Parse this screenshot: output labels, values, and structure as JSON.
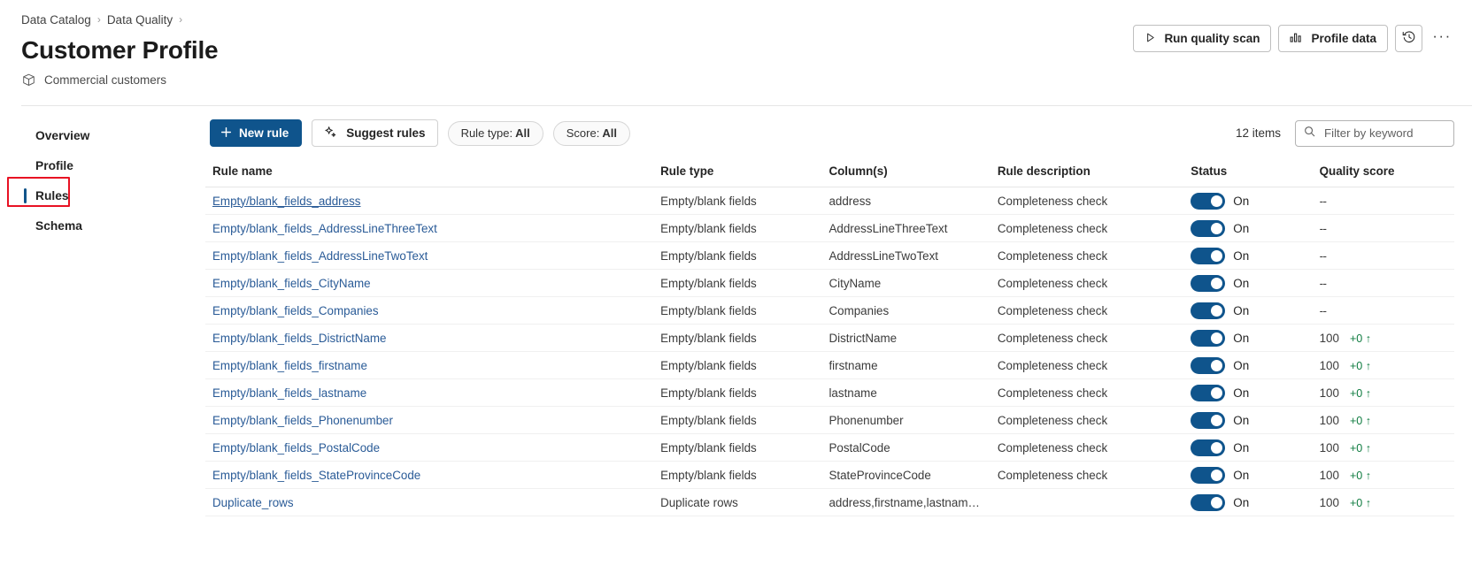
{
  "breadcrumb": {
    "items": [
      "Data Catalog",
      "Data Quality"
    ],
    "separator": "›"
  },
  "header": {
    "title": "Customer Profile",
    "subtitle": "Commercial customers",
    "subtitle_icon": "box-icon",
    "actions": {
      "run_quality_scan": "Run quality scan",
      "run_quality_scan_icon": "play-icon",
      "profile_data": "Profile data",
      "profile_data_icon": "bar-chart-icon",
      "history_icon": "history-clock-icon",
      "more_label": "···"
    }
  },
  "sidebar": {
    "items": [
      {
        "label": "Overview",
        "selected": false
      },
      {
        "label": "Profile",
        "selected": false
      },
      {
        "label": "Rules",
        "selected": true
      },
      {
        "label": "Schema",
        "selected": false
      }
    ],
    "annotation_color": "#e81123",
    "selected_indicator_color": "#11548a"
  },
  "toolbar": {
    "new_rule": "New rule",
    "new_rule_icon": "plus-icon",
    "suggest_rules": "Suggest rules",
    "suggest_rules_icon": "sparkle-icon",
    "filters": [
      {
        "prefix": "Rule type:",
        "value": "All"
      },
      {
        "prefix": "Score:",
        "value": "All"
      }
    ],
    "item_count": "12 items",
    "search_placeholder": "Filter by keyword",
    "search_value": "",
    "search_icon": "search-icon"
  },
  "table": {
    "columns": [
      "Rule name",
      "Rule type",
      "Column(s)",
      "Rule description",
      "Status",
      "Quality score"
    ],
    "toggle_on_label": "On",
    "no_score_text": "--",
    "rows": [
      {
        "name": "Empty/blank_fields_address",
        "type": "Empty/blank fields",
        "columns": "address",
        "description": "Completeness check",
        "status": "On",
        "score": "--",
        "delta": ""
      },
      {
        "name": "Empty/blank_fields_AddressLineThreeText",
        "type": "Empty/blank fields",
        "columns": "AddressLineThreeText",
        "description": "Completeness check",
        "status": "On",
        "score": "--",
        "delta": ""
      },
      {
        "name": "Empty/blank_fields_AddressLineTwoText",
        "type": "Empty/blank fields",
        "columns": "AddressLineTwoText",
        "description": "Completeness check",
        "status": "On",
        "score": "--",
        "delta": ""
      },
      {
        "name": "Empty/blank_fields_CityName",
        "type": "Empty/blank fields",
        "columns": "CityName",
        "description": "Completeness check",
        "status": "On",
        "score": "--",
        "delta": ""
      },
      {
        "name": "Empty/blank_fields_Companies",
        "type": "Empty/blank fields",
        "columns": "Companies",
        "description": "Completeness check",
        "status": "On",
        "score": "--",
        "delta": ""
      },
      {
        "name": "Empty/blank_fields_DistrictName",
        "type": "Empty/blank fields",
        "columns": "DistrictName",
        "description": "Completeness check",
        "status": "On",
        "score": "100",
        "delta": "+0 ↑"
      },
      {
        "name": "Empty/blank_fields_firstname",
        "type": "Empty/blank fields",
        "columns": "firstname",
        "description": "Completeness check",
        "status": "On",
        "score": "100",
        "delta": "+0 ↑"
      },
      {
        "name": "Empty/blank_fields_lastname",
        "type": "Empty/blank fields",
        "columns": "lastname",
        "description": "Completeness check",
        "status": "On",
        "score": "100",
        "delta": "+0 ↑"
      },
      {
        "name": "Empty/blank_fields_Phonenumber",
        "type": "Empty/blank fields",
        "columns": "Phonenumber",
        "description": "Completeness check",
        "status": "On",
        "score": "100",
        "delta": "+0 ↑"
      },
      {
        "name": "Empty/blank_fields_PostalCode",
        "type": "Empty/blank fields",
        "columns": "PostalCode",
        "description": "Completeness check",
        "status": "On",
        "score": "100",
        "delta": "+0 ↑"
      },
      {
        "name": "Empty/blank_fields_StateProvinceCode",
        "type": "Empty/blank fields",
        "columns": "StateProvinceCode",
        "description": "Completeness check",
        "status": "On",
        "score": "100",
        "delta": "+0 ↑"
      },
      {
        "name": "Duplicate_rows",
        "type": "Duplicate rows",
        "columns": "address,firstname,lastname...",
        "description": "",
        "status": "On",
        "score": "100",
        "delta": "+0 ↑"
      }
    ]
  }
}
